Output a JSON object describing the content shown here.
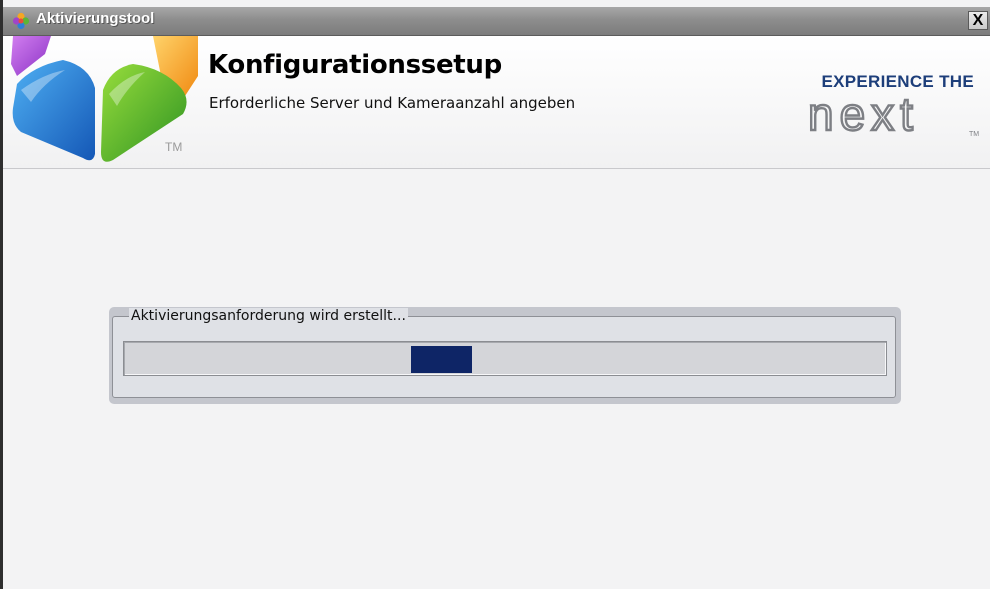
{
  "window": {
    "title": "Aktivierungstool",
    "close_label": "X",
    "icon": "flower-app-icon"
  },
  "header": {
    "title": "Konfigurationssetup",
    "subtitle": "Erforderliche Server und Kameraanzahl angeben",
    "logo_tm": "TM",
    "brand_tagline": "EXPERIENCE THE",
    "brand_wordmark": "next",
    "brand_tm": "TM"
  },
  "progress": {
    "label": "Aktivierungsanforderung wird erstellt...",
    "style": "marquee",
    "chunk_position": 0.41,
    "chunk_color": "#0e2566"
  },
  "colors": {
    "titlebar": "#8d8d8d",
    "brand_blue": "#1d3e7a",
    "background": "#f3f3f4"
  }
}
